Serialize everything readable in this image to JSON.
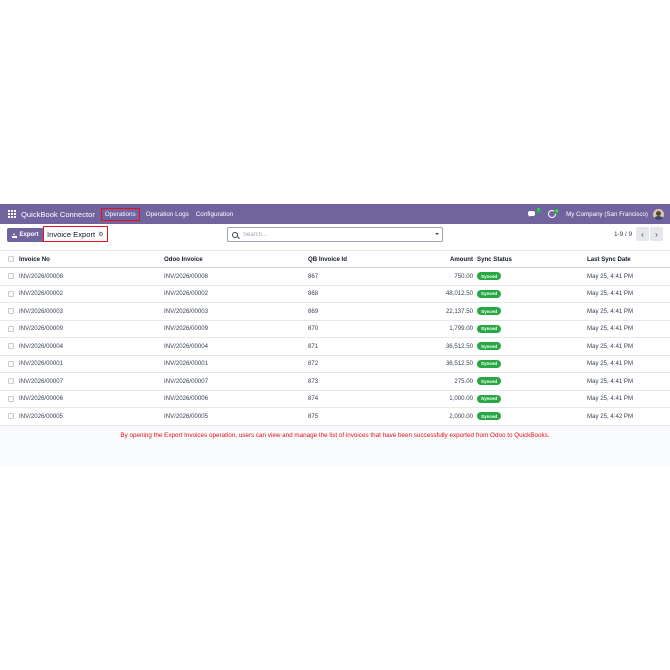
{
  "navbar": {
    "app_title": "QuickBook Connector",
    "menu": [
      "Operations",
      "Operation Logs",
      "Configuration"
    ],
    "chat_badge": "7",
    "activity_badge": "4",
    "company": "My Company (San Francisco)"
  },
  "control": {
    "export_label": "Export",
    "breadcrumb": "Invoice Export",
    "search_placeholder": "Search...",
    "pager": "1-9 / 9",
    "prev_glyph": "‹",
    "next_glyph": "›"
  },
  "table": {
    "columns": [
      "Invoice No",
      "Odoo Invoice",
      "QB Invoice Id",
      "Amount",
      "Sync Status",
      "Last Sync Date"
    ],
    "rows": [
      {
        "invoice_no": "INV/2026/00008",
        "odoo_invoice": "INV/2026/00008",
        "qb_id": "867",
        "amount": "750.00",
        "status": "Synced",
        "date": "May 25, 4:41 PM"
      },
      {
        "invoice_no": "INV/2026/00002",
        "odoo_invoice": "INV/2026/00002",
        "qb_id": "868",
        "amount": "48,012.50",
        "status": "Synced",
        "date": "May 25, 4:41 PM"
      },
      {
        "invoice_no": "INV/2026/00003",
        "odoo_invoice": "INV/2026/00003",
        "qb_id": "869",
        "amount": "22,137.50",
        "status": "Synced",
        "date": "May 25, 4:41 PM"
      },
      {
        "invoice_no": "INV/2026/00009",
        "odoo_invoice": "INV/2026/00009",
        "qb_id": "870",
        "amount": "1,799.00",
        "status": "Synced",
        "date": "May 25, 4:41 PM"
      },
      {
        "invoice_no": "INV/2026/00004",
        "odoo_invoice": "INV/2026/00004",
        "qb_id": "871",
        "amount": "36,512.50",
        "status": "Synced",
        "date": "May 25, 4:41 PM"
      },
      {
        "invoice_no": "INV/2026/00001",
        "odoo_invoice": "INV/2026/00001",
        "qb_id": "872",
        "amount": "36,512.50",
        "status": "Synced",
        "date": "May 25, 4:41 PM"
      },
      {
        "invoice_no": "INV/2026/00007",
        "odoo_invoice": "INV/2026/00007",
        "qb_id": "873",
        "amount": "275.00",
        "status": "Synced",
        "date": "May 25, 4:41 PM"
      },
      {
        "invoice_no": "INV/2026/00006",
        "odoo_invoice": "INV/2026/00006",
        "qb_id": "874",
        "amount": "1,000.00",
        "status": "Synced",
        "date": "May 25, 4:41 PM"
      },
      {
        "invoice_no": "INV/2026/00005",
        "odoo_invoice": "INV/2026/00005",
        "qb_id": "875",
        "amount": "2,000.00",
        "status": "Synced",
        "date": "May 25, 4:42 PM"
      }
    ]
  },
  "note": "By opening the Export Invoices operation, users can view and manage the list of invoices that have been successfully exported from Odoo to QuickBooks.",
  "colors": {
    "navbar": "#71639e",
    "highlight": "#e4111b",
    "synced": "#28a745"
  },
  "icons": [
    "apps-grid-icon",
    "chat-icon",
    "clock-icon",
    "avatar",
    "upload-icon",
    "gear-icon",
    "search-icon",
    "dropdown-caret-icon"
  ]
}
